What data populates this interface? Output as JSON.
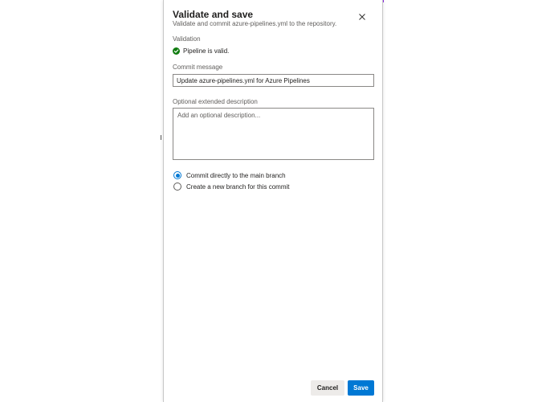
{
  "dialog": {
    "title": "Validate and save",
    "subtitle": "Validate and commit azure-pipelines.yml to the repository.",
    "close_icon": "close-icon"
  },
  "validation": {
    "label": "Validation",
    "status_icon": "check-circle-icon",
    "status_color": "#107c10",
    "status_text": "Pipeline is valid."
  },
  "commit": {
    "label": "Commit message",
    "value": "Update azure-pipelines.yml for Azure Pipelines"
  },
  "description": {
    "label": "Optional extended description",
    "placeholder": "Add an optional description..."
  },
  "branch_options": [
    {
      "label": "Commit directly to the main branch",
      "selected": true
    },
    {
      "label": "Create a new branch for this commit",
      "selected": false
    }
  ],
  "actions": {
    "cancel_label": "Cancel",
    "save_label": "Save",
    "accent_color": "#0078d4"
  }
}
